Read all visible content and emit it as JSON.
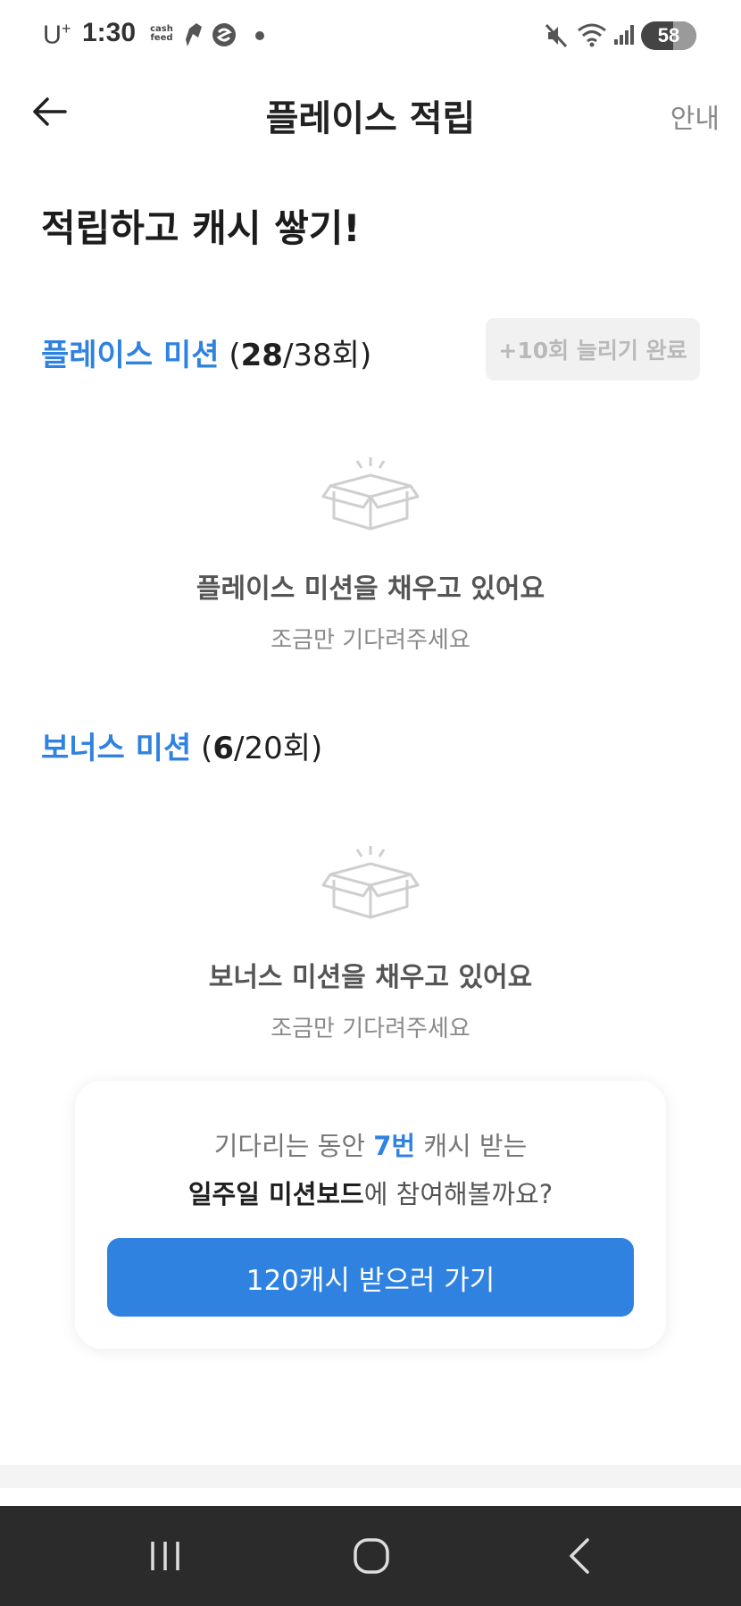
{
  "status_bar": {
    "carrier": "U",
    "carrier_sup": "+",
    "time": "1:30",
    "cashfeed_label_top": "cash",
    "cashfeed_label_bottom": "feed",
    "battery": "58",
    "battery_level_percent": 58
  },
  "app_bar": {
    "title": "플레이스 적립",
    "guide_label": "안내",
    "back_icon": "arrow-left-icon"
  },
  "headline": "적립하고 캐시 쌓기!",
  "place_mission": {
    "title": "플레이스 미션",
    "open_paren": " (",
    "done": "28",
    "total": "/38회",
    "close_paren": ")",
    "extend_button": "+10회 늘리기 완료",
    "empty_title": "플레이스 미션을 채우고 있어요",
    "empty_subtitle": "조금만 기다려주세요"
  },
  "bonus_mission": {
    "title": "보너스 미션",
    "open_paren": " (",
    "done": "6",
    "total": "/20회",
    "close_paren": ")",
    "empty_title": "보너스 미션을 채우고 있어요",
    "empty_subtitle": "조금만 기다려주세요"
  },
  "promo_card": {
    "line1_prefix": "기다리는 동안 ",
    "line1_highlight": "7번",
    "line1_suffix": " 캐시 받는",
    "line2_bold": "일주일 미션보드",
    "line2_suffix": "에 참여해볼까요?",
    "cta_label": "120캐시 받으러 가기"
  },
  "colors": {
    "accent": "#2f82e0",
    "nav_bar": "#2b2b2b"
  }
}
